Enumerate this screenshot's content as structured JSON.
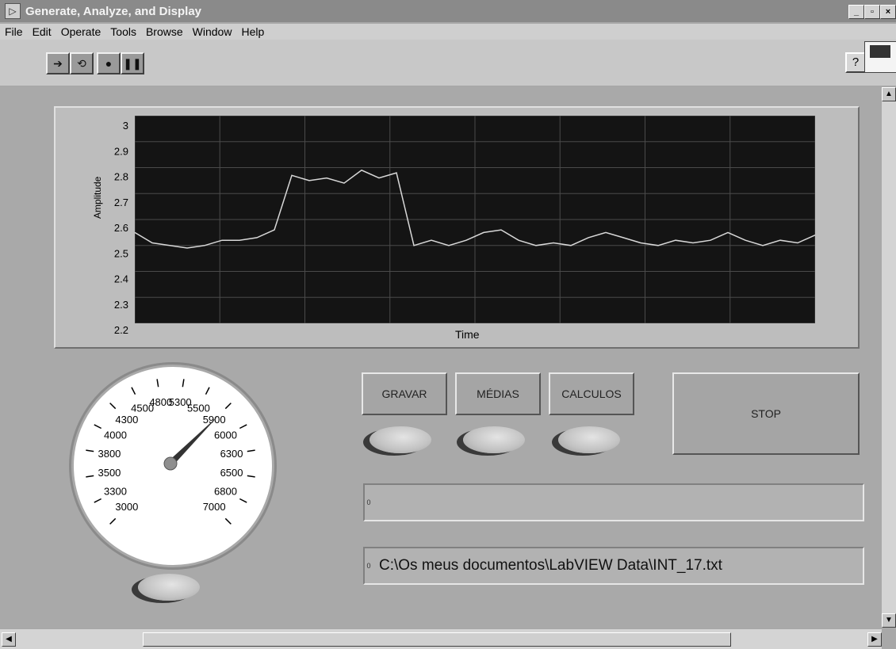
{
  "window": {
    "title": "Generate, Analyze, and Display"
  },
  "menu": [
    "File",
    "Edit",
    "Operate",
    "Tools",
    "Browse",
    "Window",
    "Help"
  ],
  "toolbar": {
    "help_label": "?"
  },
  "graph": {
    "xlabel": "Time",
    "ylabel": "Amplitude",
    "y_ticks": [
      "3",
      "2.9",
      "2.8",
      "2.7",
      "2.6",
      "2.5",
      "2.4",
      "2.3",
      "2.2"
    ]
  },
  "chart_data": {
    "type": "line",
    "ylim": [
      2.2,
      3.0
    ],
    "grid": true,
    "xlabel": "Time",
    "ylabel": "Amplitude",
    "series": [
      {
        "values": [
          2.55,
          2.51,
          2.5,
          2.49,
          2.5,
          2.52,
          2.52,
          2.53,
          2.56,
          2.77,
          2.75,
          2.76,
          2.74,
          2.79,
          2.76,
          2.78,
          2.5,
          2.52,
          2.5,
          2.52,
          2.55,
          2.56,
          2.52,
          2.5,
          2.51,
          2.5,
          2.53,
          2.55,
          2.53,
          2.51,
          2.5,
          2.52,
          2.51,
          2.52,
          2.55,
          2.52,
          2.5,
          2.52,
          2.51,
          2.54
        ]
      }
    ]
  },
  "gauge": {
    "labels": [
      "3000",
      "3300",
      "3500",
      "3800",
      "4000",
      "4300",
      "4500",
      "4800",
      "5300",
      "5500",
      "5900",
      "6000",
      "6300",
      "6500",
      "6800",
      "7000"
    ],
    "needle_value": 5900
  },
  "buttons": {
    "gravar": "GRAVAR",
    "medias": "MÉDIAS",
    "calculos": "CALCULOS",
    "stop": "STOP"
  },
  "fields": {
    "field1": "",
    "field2": "C:\\Os meus documentos\\LabVIEW Data\\INT_17.txt",
    "index_label": "0"
  }
}
